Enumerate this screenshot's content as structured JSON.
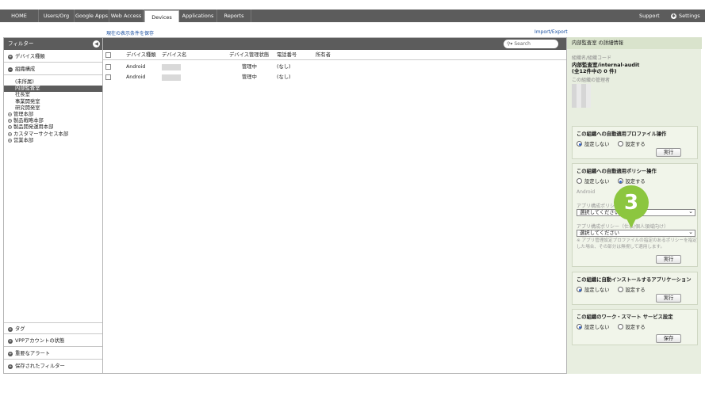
{
  "nav": {
    "items": [
      {
        "label": "HOME"
      },
      {
        "label": "Users/Org"
      },
      {
        "label": "Google Apps"
      },
      {
        "label": "Web Access"
      },
      {
        "label": "Devices"
      },
      {
        "label": "Applications"
      },
      {
        "label": "Reports"
      }
    ],
    "active": "Devices",
    "support": "Support",
    "settings": "Settings"
  },
  "links": {
    "save_condition": "現在の表示条件を保存",
    "import_export": "Import/Export"
  },
  "filter": {
    "title": "フィルター",
    "device_type": "デバイス種類",
    "org": "組織構成",
    "org_items": [
      {
        "label": "(未所属)",
        "indent": false,
        "expandable": false
      },
      {
        "label": "内部監査室",
        "indent": false,
        "expandable": false
      },
      {
        "label": "社長室",
        "indent": false,
        "expandable": false
      },
      {
        "label": "事業開発室",
        "indent": false,
        "expandable": false
      },
      {
        "label": "研究開発室",
        "indent": false,
        "expandable": false
      },
      {
        "label": "管理本部",
        "indent": false,
        "expandable": true
      },
      {
        "label": "製品戦略本部",
        "indent": false,
        "expandable": true
      },
      {
        "label": "製品開発運用本部",
        "indent": false,
        "expandable": true
      },
      {
        "label": "カスタマーサクセス本部",
        "indent": false,
        "expandable": true
      },
      {
        "label": "営業本部",
        "indent": false,
        "expandable": true
      }
    ],
    "selected_org": "内部監査室",
    "bottom_sections": [
      "タグ",
      "VPPアカウントの状態",
      "重要なアラート",
      "保存されたフィルター"
    ]
  },
  "search": {
    "placeholder": "Search"
  },
  "table": {
    "headers": [
      "デバイス種類",
      "デバイス名",
      "デバイス管理状態",
      "電話番号",
      "所有者"
    ],
    "rows": [
      {
        "type": "Android",
        "status": "管理中",
        "phone": "(なし)"
      },
      {
        "type": "Android",
        "status": "管理中",
        "phone": "(なし)"
      }
    ]
  },
  "detail": {
    "title": "内部監査室 の詳細情報",
    "org_code_label": "組織名/組織コード",
    "org_code_value": "内部監査室/internal-audit",
    "count_value": "(全12件中の 0 件)",
    "admin_label": "この組織の管理者",
    "profile_card": {
      "title": "この組織への自動適用プロファイル操作",
      "opt1": "設定しない",
      "opt2": "設定する",
      "selected": "設定しない",
      "button": "実行"
    },
    "policy_card": {
      "title": "この組織への自動適用ポリシー操作",
      "opt1": "設定しない",
      "opt2": "設定する",
      "selected": "設定する",
      "os_label": "Android",
      "policy1_label": "アプリ構成ポリシー",
      "policy1_value": "選択してください",
      "policy2_label": "アプリ構成ポリシー（仕事/個人領域向け）",
      "policy2_value": "選択してください",
      "note": "※ アプリ管理設定プロファイルの指定のあるポリシーを指定した場合、その部分は無視して適用します。",
      "button": "実行"
    },
    "install_card": {
      "title": "この組織に自動インストールするアプリケーション",
      "opt1": "設定しない",
      "opt2": "設定する",
      "selected": "設定しない",
      "button": "実行"
    },
    "work_card": {
      "title": "この組織のワーク・スマート サービス設定",
      "opt1": "設定しない",
      "opt2": "設定する",
      "selected": "設定しない",
      "button": "保存"
    }
  },
  "step_badge": "3",
  "colors": {
    "nav_bg": "#5c5c5c",
    "detail_bg": "#e8eee0",
    "badge": "#8cc63f",
    "link": "#1a4fa0"
  }
}
